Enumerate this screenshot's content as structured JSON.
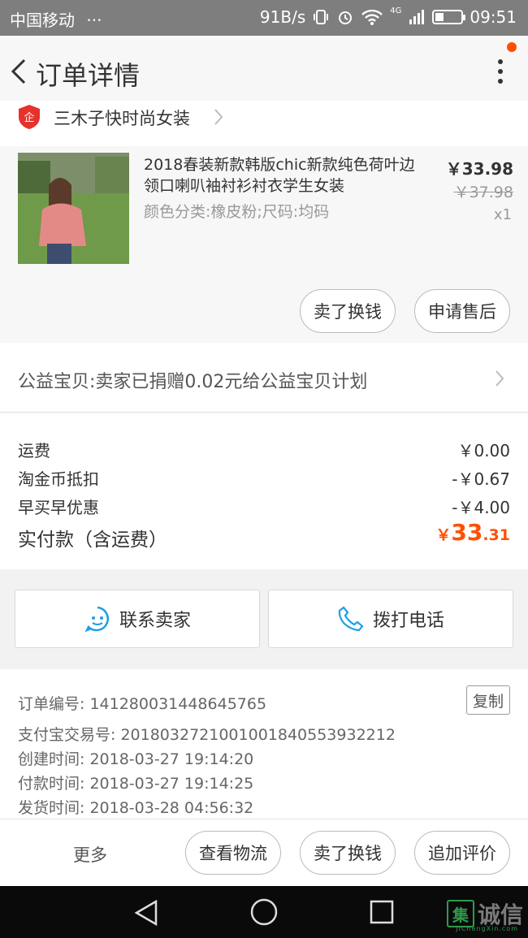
{
  "status_bar": {
    "carrier": "中国移动",
    "dots": "···",
    "speed": "91B/s",
    "time": "09:51",
    "network": "4G",
    "icons": [
      "vibrate-icon",
      "alarm-icon",
      "wifi-icon",
      "signal-icon",
      "battery-icon"
    ]
  },
  "header": {
    "title": "订单详情",
    "notification_color": "#ff5000"
  },
  "shop": {
    "name": "三木子快时尚女装",
    "badge_text": "企",
    "badge_color": "#e5322d"
  },
  "item": {
    "title": "2018春装新款韩版chic新款纯色荷叶边领口喇叭袖衬衫衬衣学生女装",
    "sku": "颜色分类:橡皮粉;尺码:均码",
    "price": "￥33.98",
    "original_price": "￥37.98",
    "quantity": "x1",
    "buttons": {
      "resell": "卖了换钱",
      "after_sale": "申请售后"
    }
  },
  "charity": {
    "text": "公益宝贝:卖家已捐赠0.02元给公益宝贝计划"
  },
  "fees": [
    {
      "label": "运费",
      "value": "￥0.00"
    },
    {
      "label": "淘金币抵扣",
      "value": "-￥0.67"
    },
    {
      "label": "早买早优惠",
      "value": "-￥4.00"
    }
  ],
  "total": {
    "label": "实付款（含运费）",
    "currency": "￥",
    "integer": "33",
    "decimal": ".31",
    "color": "#ff5000"
  },
  "actions": {
    "contact_seller": "联系卖家",
    "call_phone": "拨打电话",
    "icon_color": "#1e9fe6"
  },
  "order_info": {
    "order_no_label": "订单编号:",
    "order_no": "141280031448645765",
    "alipay_label": "支付宝交易号:",
    "alipay_no": "2018032721001001840553932212",
    "created_label": "创建时间:",
    "created": "2018-03-27 19:14:20",
    "paid_label": "付款时间:",
    "paid": "2018-03-27 19:14:25",
    "shipped_label": "发货时间:",
    "shipped": "2018-03-28 04:56:32",
    "copy": "复制"
  },
  "bottom_bar": {
    "more": "更多",
    "logistics": "查看物流",
    "resell": "卖了换钱",
    "add_review": "追加评价"
  },
  "watermark": {
    "glyph": "集",
    "text": "诚信",
    "sub": "JiChengXin.com"
  }
}
